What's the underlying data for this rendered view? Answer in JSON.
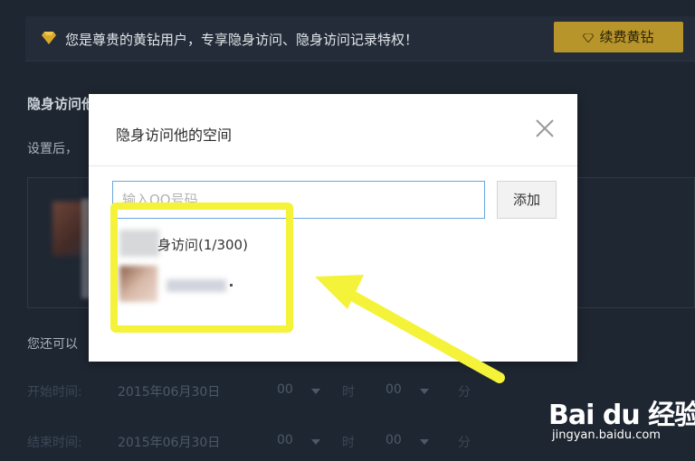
{
  "banner": {
    "message": "您是尊贵的黄钻用户，专享隐身访问、隐身访问记录特权！",
    "renew_label": "续费黄钻"
  },
  "background": {
    "heading": "隐身访问他的空间",
    "note": "设置后，",
    "also_text": "您还可以",
    "rows": [
      {
        "label": "开始时间:",
        "date": "2015年06月30日",
        "hour": "00",
        "hour_unit": "时",
        "minute": "00",
        "minute_unit": "分"
      },
      {
        "label": "结束时间:",
        "date": "2015年06月30日",
        "hour": "00",
        "hour_unit": "时",
        "minute": "00",
        "minute_unit": "分"
      }
    ]
  },
  "modal": {
    "title": "隐身访问他的空间",
    "input_placeholder": "输入QQ号码",
    "input_value": "",
    "add_label": "添加",
    "visit_count_text": "身访问(1/300)"
  },
  "watermark": {
    "logo": "Bai du 经验",
    "url": "jingyan.baidu.com"
  },
  "colors": {
    "page_bg": "#1e2631",
    "accent_gold": "#b8952a",
    "annotation_yellow": "#f5f23a",
    "input_border": "#6aa6dd"
  }
}
